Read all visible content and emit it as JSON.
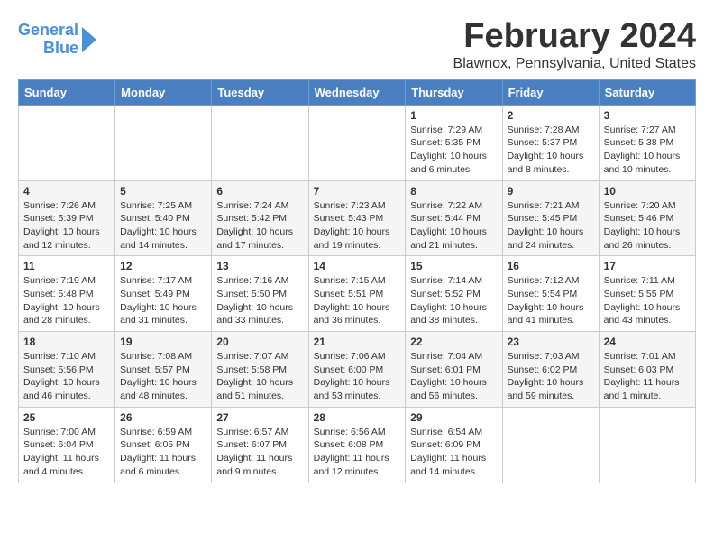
{
  "header": {
    "logo_line1": "General",
    "logo_line2": "Blue",
    "title": "February 2024",
    "location": "Blawnox, Pennsylvania, United States"
  },
  "calendar": {
    "days_of_week": [
      "Sunday",
      "Monday",
      "Tuesday",
      "Wednesday",
      "Thursday",
      "Friday",
      "Saturday"
    ],
    "weeks": [
      [
        {
          "day": "",
          "info": ""
        },
        {
          "day": "",
          "info": ""
        },
        {
          "day": "",
          "info": ""
        },
        {
          "day": "",
          "info": ""
        },
        {
          "day": "1",
          "info": "Sunrise: 7:29 AM\nSunset: 5:35 PM\nDaylight: 10 hours\nand 6 minutes."
        },
        {
          "day": "2",
          "info": "Sunrise: 7:28 AM\nSunset: 5:37 PM\nDaylight: 10 hours\nand 8 minutes."
        },
        {
          "day": "3",
          "info": "Sunrise: 7:27 AM\nSunset: 5:38 PM\nDaylight: 10 hours\nand 10 minutes."
        }
      ],
      [
        {
          "day": "4",
          "info": "Sunrise: 7:26 AM\nSunset: 5:39 PM\nDaylight: 10 hours\nand 12 minutes."
        },
        {
          "day": "5",
          "info": "Sunrise: 7:25 AM\nSunset: 5:40 PM\nDaylight: 10 hours\nand 14 minutes."
        },
        {
          "day": "6",
          "info": "Sunrise: 7:24 AM\nSunset: 5:42 PM\nDaylight: 10 hours\nand 17 minutes."
        },
        {
          "day": "7",
          "info": "Sunrise: 7:23 AM\nSunset: 5:43 PM\nDaylight: 10 hours\nand 19 minutes."
        },
        {
          "day": "8",
          "info": "Sunrise: 7:22 AM\nSunset: 5:44 PM\nDaylight: 10 hours\nand 21 minutes."
        },
        {
          "day": "9",
          "info": "Sunrise: 7:21 AM\nSunset: 5:45 PM\nDaylight: 10 hours\nand 24 minutes."
        },
        {
          "day": "10",
          "info": "Sunrise: 7:20 AM\nSunset: 5:46 PM\nDaylight: 10 hours\nand 26 minutes."
        }
      ],
      [
        {
          "day": "11",
          "info": "Sunrise: 7:19 AM\nSunset: 5:48 PM\nDaylight: 10 hours\nand 28 minutes."
        },
        {
          "day": "12",
          "info": "Sunrise: 7:17 AM\nSunset: 5:49 PM\nDaylight: 10 hours\nand 31 minutes."
        },
        {
          "day": "13",
          "info": "Sunrise: 7:16 AM\nSunset: 5:50 PM\nDaylight: 10 hours\nand 33 minutes."
        },
        {
          "day": "14",
          "info": "Sunrise: 7:15 AM\nSunset: 5:51 PM\nDaylight: 10 hours\nand 36 minutes."
        },
        {
          "day": "15",
          "info": "Sunrise: 7:14 AM\nSunset: 5:52 PM\nDaylight: 10 hours\nand 38 minutes."
        },
        {
          "day": "16",
          "info": "Sunrise: 7:12 AM\nSunset: 5:54 PM\nDaylight: 10 hours\nand 41 minutes."
        },
        {
          "day": "17",
          "info": "Sunrise: 7:11 AM\nSunset: 5:55 PM\nDaylight: 10 hours\nand 43 minutes."
        }
      ],
      [
        {
          "day": "18",
          "info": "Sunrise: 7:10 AM\nSunset: 5:56 PM\nDaylight: 10 hours\nand 46 minutes."
        },
        {
          "day": "19",
          "info": "Sunrise: 7:08 AM\nSunset: 5:57 PM\nDaylight: 10 hours\nand 48 minutes."
        },
        {
          "day": "20",
          "info": "Sunrise: 7:07 AM\nSunset: 5:58 PM\nDaylight: 10 hours\nand 51 minutes."
        },
        {
          "day": "21",
          "info": "Sunrise: 7:06 AM\nSunset: 6:00 PM\nDaylight: 10 hours\nand 53 minutes."
        },
        {
          "day": "22",
          "info": "Sunrise: 7:04 AM\nSunset: 6:01 PM\nDaylight: 10 hours\nand 56 minutes."
        },
        {
          "day": "23",
          "info": "Sunrise: 7:03 AM\nSunset: 6:02 PM\nDaylight: 10 hours\nand 59 minutes."
        },
        {
          "day": "24",
          "info": "Sunrise: 7:01 AM\nSunset: 6:03 PM\nDaylight: 11 hours\nand 1 minute."
        }
      ],
      [
        {
          "day": "25",
          "info": "Sunrise: 7:00 AM\nSunset: 6:04 PM\nDaylight: 11 hours\nand 4 minutes."
        },
        {
          "day": "26",
          "info": "Sunrise: 6:59 AM\nSunset: 6:05 PM\nDaylight: 11 hours\nand 6 minutes."
        },
        {
          "day": "27",
          "info": "Sunrise: 6:57 AM\nSunset: 6:07 PM\nDaylight: 11 hours\nand 9 minutes."
        },
        {
          "day": "28",
          "info": "Sunrise: 6:56 AM\nSunset: 6:08 PM\nDaylight: 11 hours\nand 12 minutes."
        },
        {
          "day": "29",
          "info": "Sunrise: 6:54 AM\nSunset: 6:09 PM\nDaylight: 11 hours\nand 14 minutes."
        },
        {
          "day": "",
          "info": ""
        },
        {
          "day": "",
          "info": ""
        }
      ]
    ]
  }
}
